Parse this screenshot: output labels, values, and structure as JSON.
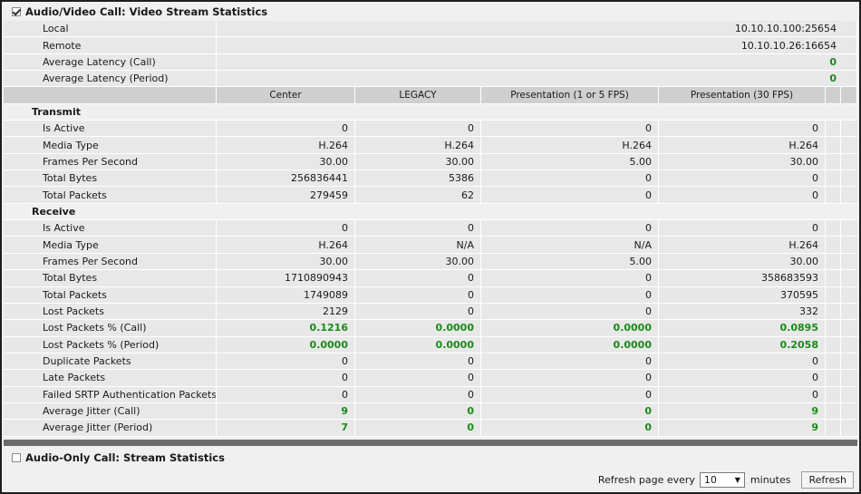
{
  "video_section": {
    "title": "Audio/Video Call: Video Stream Statistics",
    "checked": true
  },
  "summary": [
    {
      "label": "Local",
      "value": "10.10.10.100:25654",
      "green": false
    },
    {
      "label": "Remote",
      "value": "10.10.10.26:16654",
      "green": false
    },
    {
      "label": "Average Latency (Call)",
      "value": "0",
      "green": true
    },
    {
      "label": "Average Latency (Period)",
      "value": "0",
      "green": true
    }
  ],
  "columns": [
    "Center",
    "LEGACY",
    "Presentation (1 or 5 FPS)",
    "Presentation (30 FPS)"
  ],
  "transmit": {
    "title": "Transmit",
    "rows": [
      {
        "label": "Is Active",
        "values": [
          "0",
          "0",
          "0",
          "0"
        ],
        "green": false
      },
      {
        "label": "Media Type",
        "values": [
          "H.264",
          "H.264",
          "H.264",
          "H.264"
        ],
        "green": false
      },
      {
        "label": "Frames Per Second",
        "values": [
          "30.00",
          "30.00",
          "5.00",
          "30.00"
        ],
        "green": false
      },
      {
        "label": "Total Bytes",
        "values": [
          "256836441",
          "5386",
          "0",
          "0"
        ],
        "green": false
      },
      {
        "label": "Total Packets",
        "values": [
          "279459",
          "62",
          "0",
          "0"
        ],
        "green": false
      }
    ]
  },
  "receive": {
    "title": "Receive",
    "rows": [
      {
        "label": "Is Active",
        "values": [
          "0",
          "0",
          "0",
          "0"
        ],
        "green": false
      },
      {
        "label": "Media Type",
        "values": [
          "H.264",
          "N/A",
          "N/A",
          "H.264"
        ],
        "green": false
      },
      {
        "label": "Frames Per Second",
        "values": [
          "30.00",
          "30.00",
          "5.00",
          "30.00"
        ],
        "green": false
      },
      {
        "label": "Total Bytes",
        "values": [
          "1710890943",
          "0",
          "0",
          "358683593"
        ],
        "green": false
      },
      {
        "label": "Total Packets",
        "values": [
          "1749089",
          "0",
          "0",
          "370595"
        ],
        "green": false
      },
      {
        "label": "Lost Packets",
        "values": [
          "2129",
          "0",
          "0",
          "332"
        ],
        "green": false
      },
      {
        "label": "Lost Packets % (Call)",
        "values": [
          "0.1216",
          "0.0000",
          "0.0000",
          "0.0895"
        ],
        "green": true
      },
      {
        "label": "Lost Packets % (Period)",
        "values": [
          "0.0000",
          "0.0000",
          "0.0000",
          "0.2058"
        ],
        "green": true
      },
      {
        "label": "Duplicate Packets",
        "values": [
          "0",
          "0",
          "0",
          "0"
        ],
        "green": false
      },
      {
        "label": "Late Packets",
        "values": [
          "0",
          "0",
          "0",
          "0"
        ],
        "green": false
      },
      {
        "label": "Failed SRTP Authentication Packets",
        "values": [
          "0",
          "0",
          "0",
          "0"
        ],
        "green": false
      },
      {
        "label": "Average Jitter (Call)",
        "values": [
          "9",
          "0",
          "0",
          "9"
        ],
        "green": true
      },
      {
        "label": "Average Jitter (Period)",
        "values": [
          "7",
          "0",
          "0",
          "9"
        ],
        "green": true
      }
    ]
  },
  "audio_section": {
    "title": "Audio-Only Call: Stream Statistics",
    "checked": false
  },
  "footer": {
    "refresh_prefix": "Refresh page every",
    "refresh_value": "10",
    "refresh_suffix": "minutes",
    "refresh_button": "Refresh"
  },
  "colors": {
    "value_green": "#1a8a1a",
    "divider": "#6b6b6b"
  }
}
